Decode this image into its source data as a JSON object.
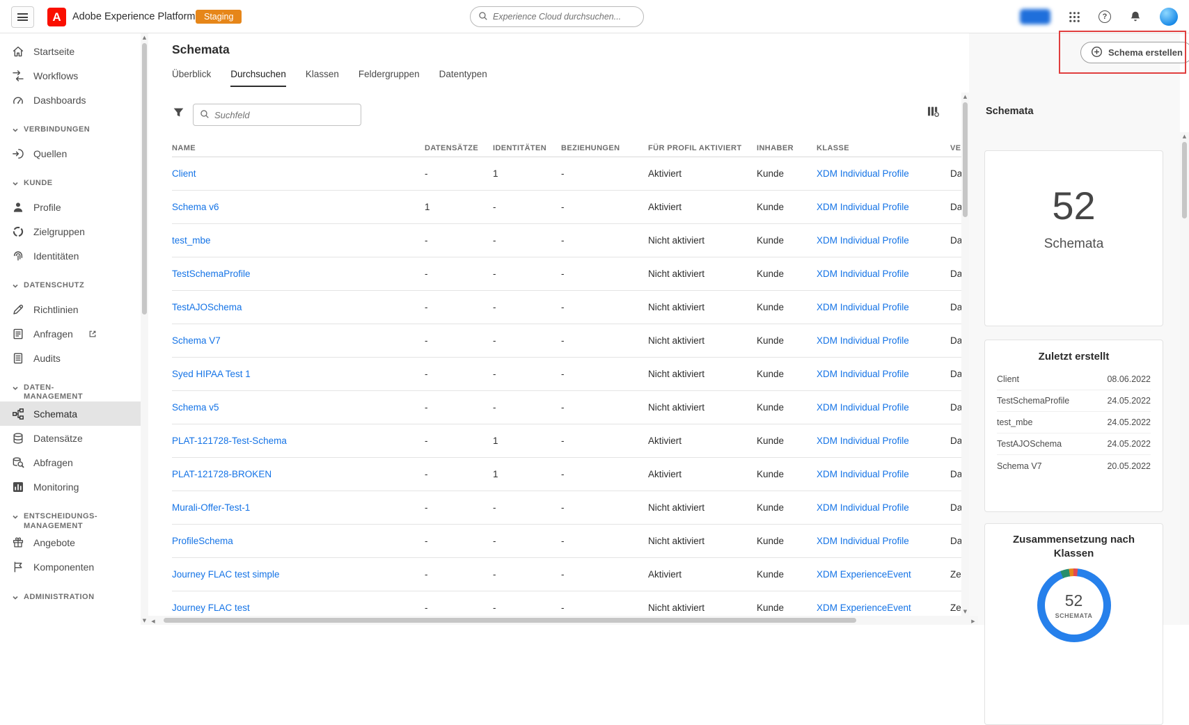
{
  "topbar": {
    "app_title": "Adobe Experience Platform",
    "env_badge": "Staging",
    "search_placeholder": "Experience Cloud durchsuchen..."
  },
  "sidebar": {
    "sections": [
      {
        "label": "VERBINDUNGEN"
      },
      {
        "label": "KUNDE"
      },
      {
        "label": "DATENSCHUTZ"
      },
      {
        "label": "DATEN-MANAGEMENT"
      },
      {
        "label": "ENTSCHEIDUNGS-MANAGEMENT"
      },
      {
        "label": "ADMINISTRATION"
      }
    ],
    "items": [
      {
        "label": "Startseite"
      },
      {
        "label": "Workflows"
      },
      {
        "label": "Dashboards"
      },
      {
        "label": "Quellen"
      },
      {
        "label": "Profile"
      },
      {
        "label": "Zielgruppen"
      },
      {
        "label": "Identitäten"
      },
      {
        "label": "Richtlinien"
      },
      {
        "label": "Anfragen"
      },
      {
        "label": "Audits"
      },
      {
        "label": "Schemata",
        "selected": true
      },
      {
        "label": "Datensätze"
      },
      {
        "label": "Abfragen"
      },
      {
        "label": "Monitoring"
      },
      {
        "label": "Angebote"
      },
      {
        "label": "Komponenten"
      }
    ]
  },
  "main": {
    "page_title": "Schemata",
    "tabs": [
      {
        "label": "Überblick"
      },
      {
        "label": "Durchsuchen",
        "active": true
      },
      {
        "label": "Klassen"
      },
      {
        "label": "Feldergruppen"
      },
      {
        "label": "Datentypen"
      }
    ],
    "create_button_label": "Schema erstellen",
    "table_search_placeholder": "Suchfeld",
    "table": {
      "columns": [
        "NAME",
        "DATENSÄTZE",
        "IDENTITÄTEN",
        "BEZIEHUNGEN",
        "FÜR PROFIL AKTIVIERT",
        "INHABER",
        "KLASSE",
        "VE"
      ],
      "rows": [
        {
          "name": "Client",
          "datasets": "-",
          "identities": "1",
          "relationships": "-",
          "profile_enabled": "Aktiviert",
          "owner": "Kunde",
          "class": "XDM Individual Profile",
          "behavior": "Da"
        },
        {
          "name": "Schema v6",
          "datasets": "1",
          "identities": "-",
          "relationships": "-",
          "profile_enabled": "Aktiviert",
          "owner": "Kunde",
          "class": "XDM Individual Profile",
          "behavior": "Da"
        },
        {
          "name": "test_mbe",
          "datasets": "-",
          "identities": "-",
          "relationships": "-",
          "profile_enabled": "Nicht aktiviert",
          "owner": "Kunde",
          "class": "XDM Individual Profile",
          "behavior": "Da"
        },
        {
          "name": "TestSchemaProfile",
          "datasets": "-",
          "identities": "-",
          "relationships": "-",
          "profile_enabled": "Nicht aktiviert",
          "owner": "Kunde",
          "class": "XDM Individual Profile",
          "behavior": "Da"
        },
        {
          "name": "TestAJOSchema",
          "datasets": "-",
          "identities": "-",
          "relationships": "-",
          "profile_enabled": "Nicht aktiviert",
          "owner": "Kunde",
          "class": "XDM Individual Profile",
          "behavior": "Da"
        },
        {
          "name": "Schema V7",
          "datasets": "-",
          "identities": "-",
          "relationships": "-",
          "profile_enabled": "Nicht aktiviert",
          "owner": "Kunde",
          "class": "XDM Individual Profile",
          "behavior": "Da"
        },
        {
          "name": "Syed HIPAA Test 1",
          "datasets": "-",
          "identities": "-",
          "relationships": "-",
          "profile_enabled": "Nicht aktiviert",
          "owner": "Kunde",
          "class": "XDM Individual Profile",
          "behavior": "Da"
        },
        {
          "name": "Schema v5",
          "datasets": "-",
          "identities": "-",
          "relationships": "-",
          "profile_enabled": "Nicht aktiviert",
          "owner": "Kunde",
          "class": "XDM Individual Profile",
          "behavior": "Da"
        },
        {
          "name": "PLAT-121728-Test-Schema",
          "datasets": "-",
          "identities": "1",
          "relationships": "-",
          "profile_enabled": "Aktiviert",
          "owner": "Kunde",
          "class": "XDM Individual Profile",
          "behavior": "Da"
        },
        {
          "name": "PLAT-121728-BROKEN",
          "datasets": "-",
          "identities": "1",
          "relationships": "-",
          "profile_enabled": "Aktiviert",
          "owner": "Kunde",
          "class": "XDM Individual Profile",
          "behavior": "Da"
        },
        {
          "name": "Murali-Offer-Test-1",
          "datasets": "-",
          "identities": "-",
          "relationships": "-",
          "profile_enabled": "Nicht aktiviert",
          "owner": "Kunde",
          "class": "XDM Individual Profile",
          "behavior": "Da"
        },
        {
          "name": "ProfileSchema",
          "datasets": "-",
          "identities": "-",
          "relationships": "-",
          "profile_enabled": "Nicht aktiviert",
          "owner": "Kunde",
          "class": "XDM Individual Profile",
          "behavior": "Da"
        },
        {
          "name": "Journey FLAC test simple",
          "datasets": "-",
          "identities": "-",
          "relationships": "-",
          "profile_enabled": "Aktiviert",
          "owner": "Kunde",
          "class": "XDM ExperienceEvent",
          "behavior": "Ze"
        },
        {
          "name": "Journey FLAC test",
          "datasets": "-",
          "identities": "-",
          "relationships": "-",
          "profile_enabled": "Nicht aktiviert",
          "owner": "Kunde",
          "class": "XDM ExperienceEvent",
          "behavior": "Ze"
        }
      ]
    }
  },
  "right_panel": {
    "heading": "Schemata",
    "count_card": {
      "value": "52",
      "label": "Schemata"
    },
    "recent_card": {
      "title": "Zuletzt erstellt",
      "items": [
        {
          "name": "Client",
          "date": "08.06.2022"
        },
        {
          "name": "TestSchemaProfile",
          "date": "24.05.2022"
        },
        {
          "name": "test_mbe",
          "date": "24.05.2022"
        },
        {
          "name": "TestAJOSchema",
          "date": "24.05.2022"
        },
        {
          "name": "Schema V7",
          "date": "20.05.2022"
        }
      ]
    },
    "composition_card": {
      "title": "Zusammensetzung nach Klassen",
      "center_value": "52",
      "center_label": "SCHEMATA"
    }
  },
  "chart_data": {
    "type": "pie",
    "title": "Zusammensetzung nach Klassen",
    "center_value": 52,
    "center_label": "SCHEMATA",
    "legend": "none",
    "segments": [
      {
        "color": "#268E6C",
        "value": 2
      },
      {
        "color": "#E68619",
        "value": 1
      },
      {
        "color": "#E34850",
        "value": 1
      },
      {
        "color": "#2680EB",
        "value": 48
      }
    ]
  },
  "icons": {
    "menu": "hamburger-icon",
    "search": "magnifier-icon",
    "apps": "grid-icon",
    "help": "question-circle-icon",
    "notifications": "bell-icon",
    "user": "avatar-circle",
    "filter": "funnel-icon",
    "create": "plus-circle-icon",
    "column_settings": "column-settings-icon",
    "external": "external-link-icon",
    "section_chevron": "chevron-down-icon"
  },
  "colors": {
    "link_blue": "#1473E6",
    "badge_orange": "#E68619",
    "adobe_red": "#FA0F00",
    "annotation_red": "#E03E3E",
    "selected_nav_bg": "#E4E4E4",
    "donut_blue": "#2680EB",
    "donut_green": "#268E6C",
    "donut_orange": "#E68619",
    "donut_red": "#E34850"
  },
  "annotation": {
    "type": "highlight-rectangle",
    "target": "create-button"
  }
}
